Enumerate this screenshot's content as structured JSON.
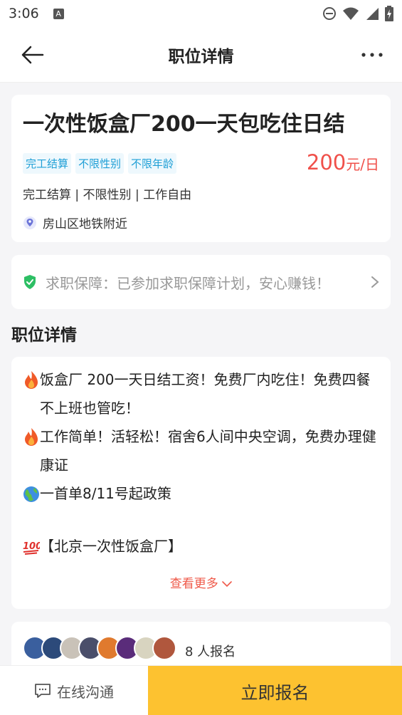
{
  "status_bar": {
    "time": "3:06",
    "left_icon": "A",
    "icons": [
      "do-not-disturb-icon",
      "wifi-icon",
      "signal-icon",
      "battery-icon"
    ]
  },
  "nav": {
    "title": "职位详情",
    "back_icon": "arrow-left-icon",
    "more_icon": "more-dots-icon"
  },
  "job": {
    "title": "一次性饭盒厂200一天包吃住日结",
    "tags": [
      "完工结算",
      "不限性别",
      "不限年龄"
    ],
    "salary_amount": "200",
    "salary_unit": "元/日",
    "description": "完工结算 | 不限性别 | 工作自由",
    "location": "房山区地铁附近"
  },
  "guarantee": {
    "text": "求职保障：已参加求职保障计划，安心赚钱！"
  },
  "details": {
    "section_title": "职位详情",
    "line1": "饭盒厂 200一天日结工资！免费厂内吃住！免费四餐 不上班也管吃！",
    "line2": "工作简单！活轻松！宿舍6人间中央空调，免费办理健康证",
    "line3": "一首单8/11号起政策",
    "line4": "【北京一次性饭盒厂】",
    "see_more": "查看更多"
  },
  "signup": {
    "count_text": "8 人报名",
    "avatar_colors": [
      "#3a5f9e",
      "#2c4a7a",
      "#c9c2b8",
      "#4a4e6a",
      "#e07a2e",
      "#5a2c7a",
      "#d8d4c0",
      "#b0573d"
    ]
  },
  "bottom": {
    "chat_label": "在线沟通",
    "apply_label": "立即报名"
  },
  "colors": {
    "accent_yellow": "#fdc230",
    "salary_red": "#f0504a",
    "tag_blue": "#1f9fd6",
    "guarantee_green": "#2dbf64"
  }
}
